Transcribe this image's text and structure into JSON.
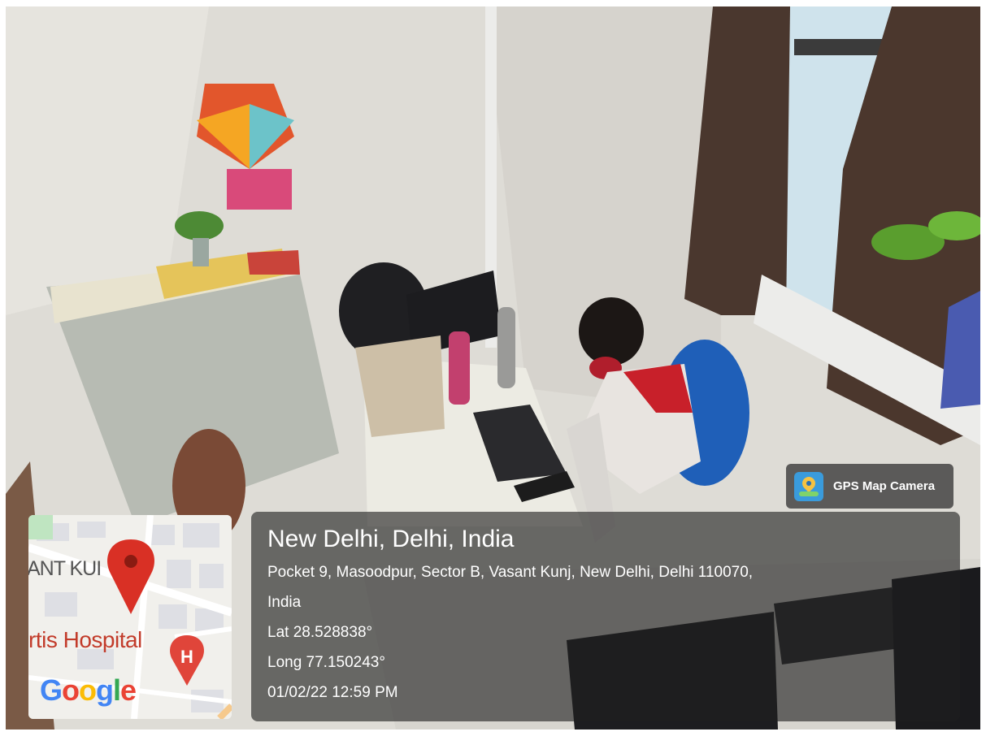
{
  "overlay": {
    "app_badge": "GPS Map Camera",
    "city": "New Delhi, Delhi, India",
    "address_line1": "Pocket 9, Masoodpur, Sector B, Vasant Kunj, New Delhi, Delhi 110070,",
    "address_line2": "India",
    "latitude": "Lat 28.528838°",
    "longitude": "Long 77.150243°",
    "datetime": "01/02/22 12:59 PM"
  },
  "map": {
    "area_label": "ANT KUI",
    "poi_label": "rtis Hospital",
    "brand": "Google",
    "poi_marker": "H"
  },
  "colors": {
    "map_pin": "#d93025",
    "hospital_marker": "#e0453a",
    "chair_blue": "#1f5fb8",
    "sweater_red": "#c8202a"
  },
  "icons": [
    "gps-map-camera-icon",
    "map-pin-icon",
    "hospital-marker-icon"
  ]
}
